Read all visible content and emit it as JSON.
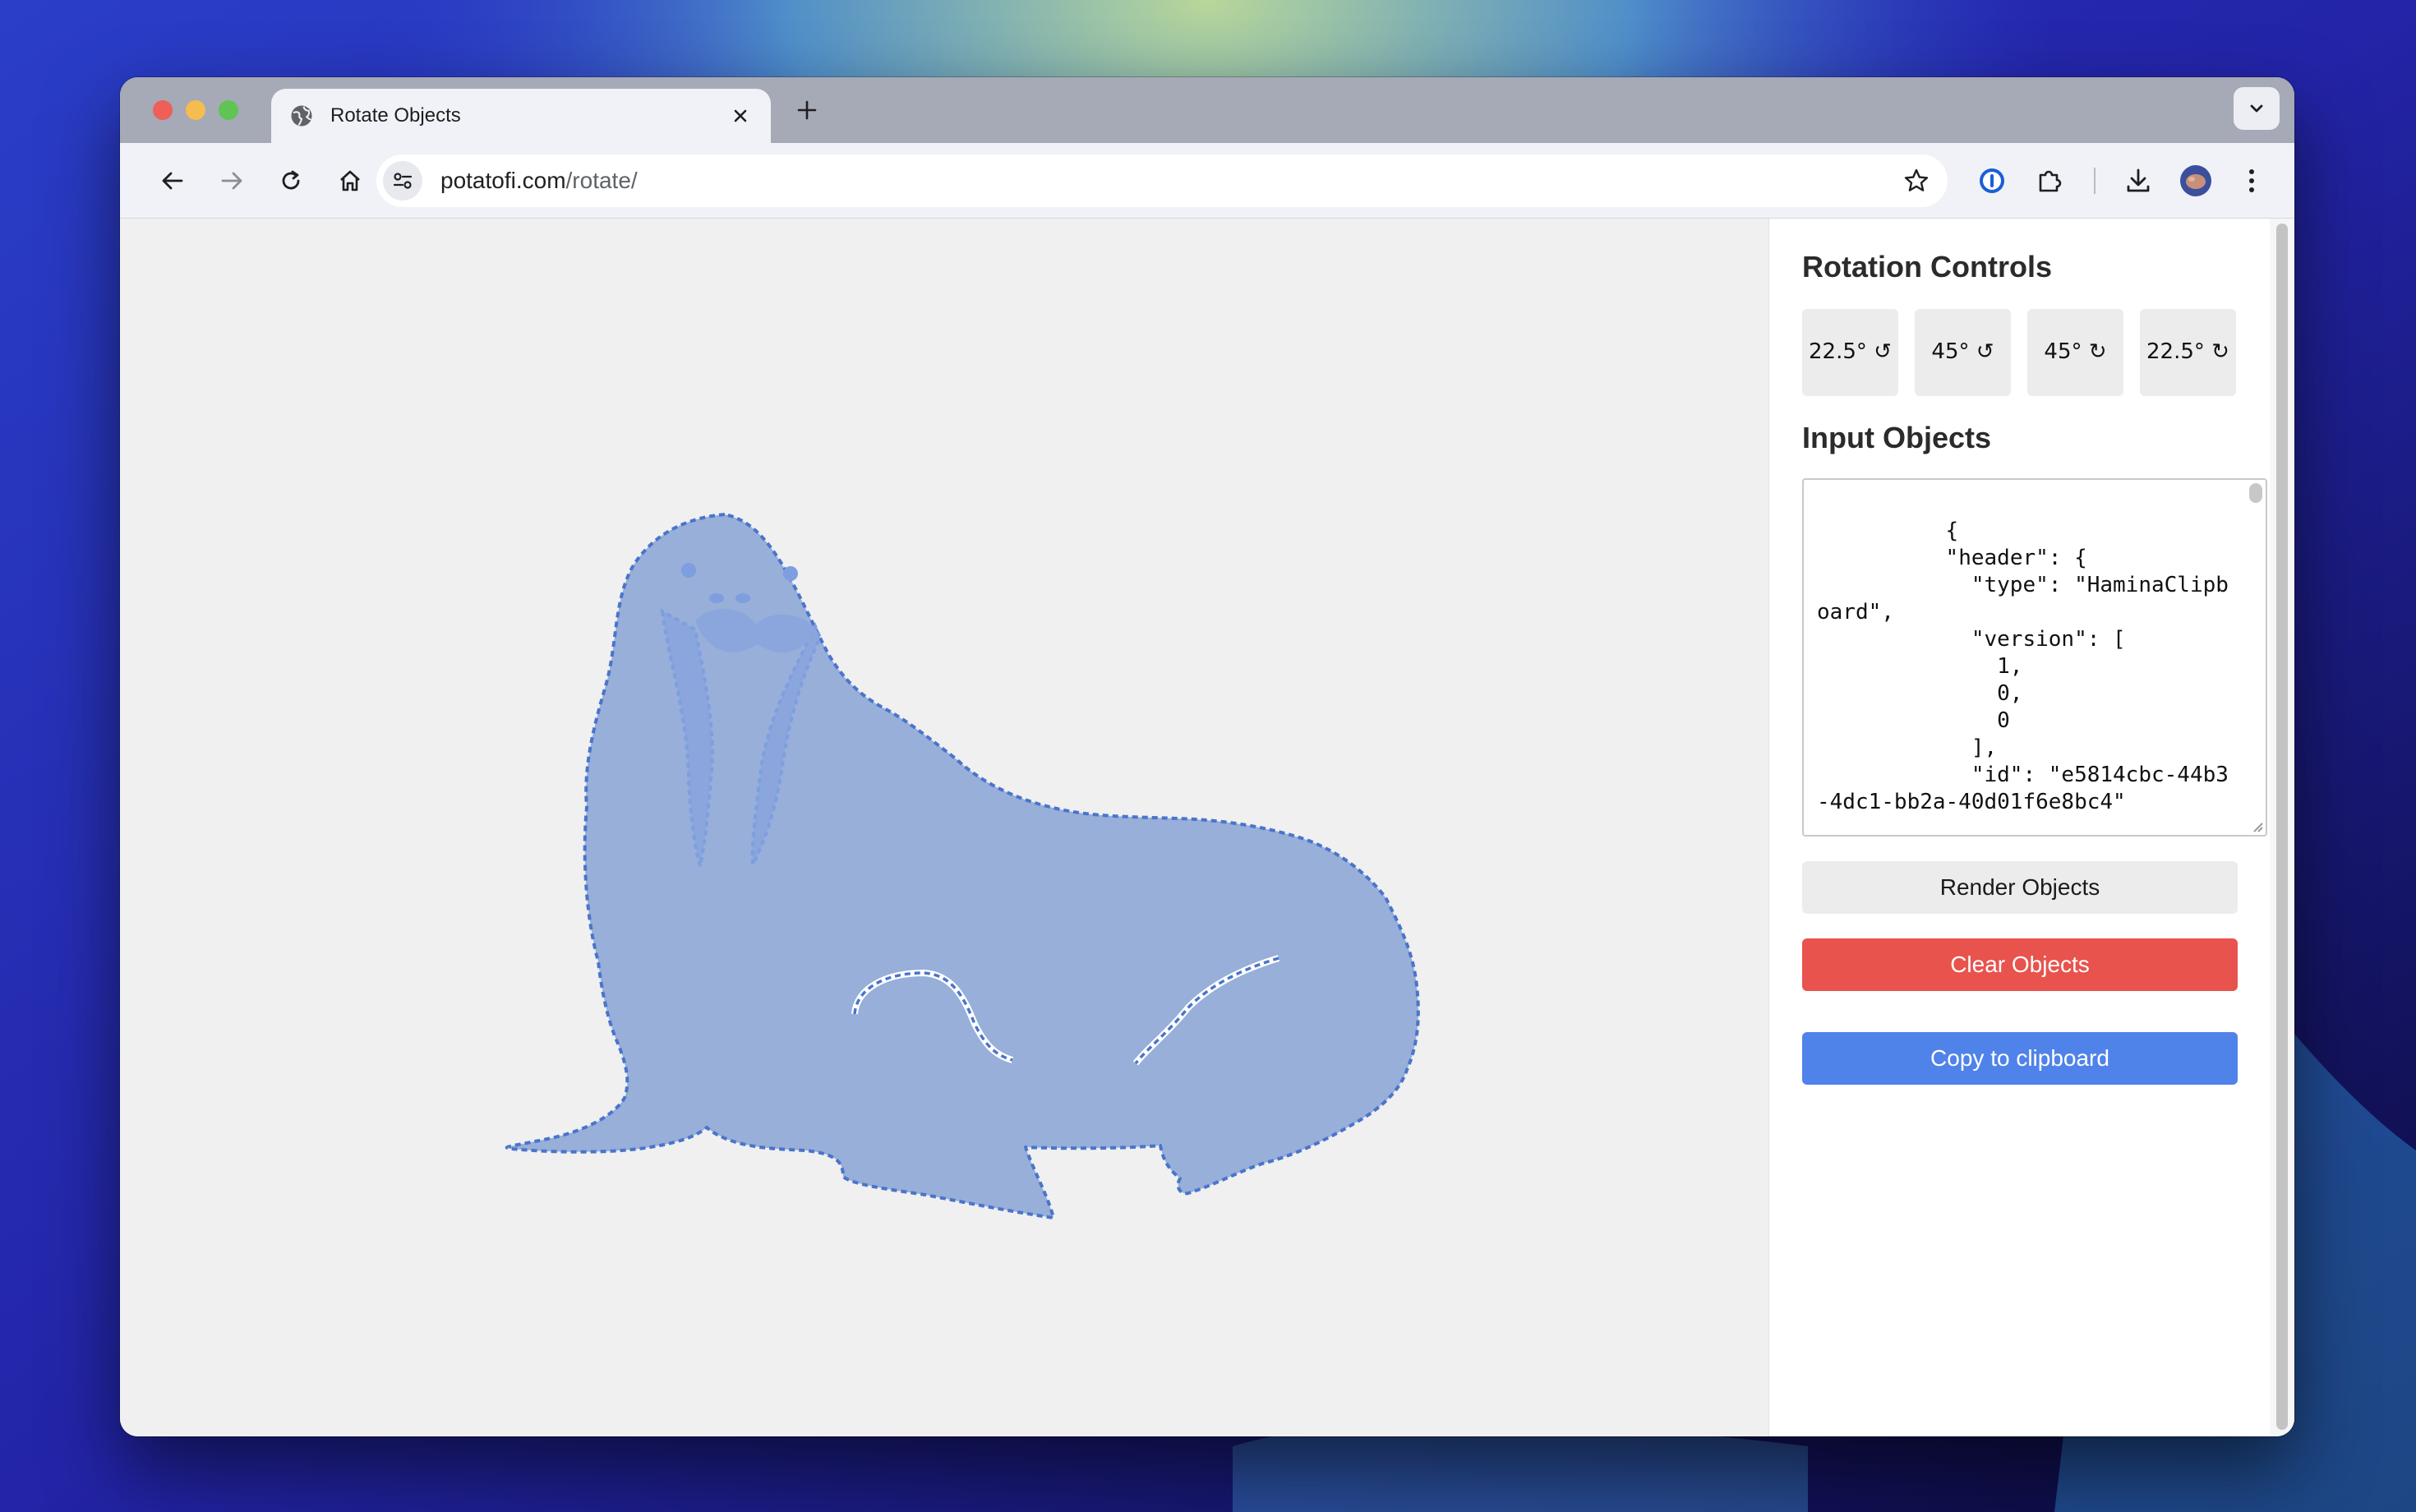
{
  "browser": {
    "tab_title": "Rotate Objects",
    "url_host": "potatofi.com",
    "url_path": "/rotate/"
  },
  "panel": {
    "rotation_heading": "Rotation Controls",
    "rotation_buttons": [
      {
        "label": "22.5° ↺"
      },
      {
        "label": "45° ↺"
      },
      {
        "label": "45° ↻"
      },
      {
        "label": "22.5° ↻"
      }
    ],
    "input_heading": "Input Objects",
    "input_text": "          {\n          \"header\": {\n            \"type\": \"HaminaClipboard\",\n            \"version\": [\n              1,\n              0,\n              0\n            ],\n            \"id\": \"e5814cbc-44b3-4dc1-bb2a-40d01f6e8bc4\"",
    "render_label": "Render Objects",
    "clear_label": "Clear Objects",
    "copy_label": "Copy to clipboard"
  },
  "colors": {
    "clear_button": "#e8534d",
    "copy_button": "#5083e9",
    "walrus_fill": "#97afd9",
    "walrus_stroke": "#4a74cc"
  },
  "icons": [
    "globe-icon",
    "close-icon",
    "plus-icon",
    "chevron-down-icon",
    "back-arrow-icon",
    "forward-arrow-icon",
    "reload-icon",
    "home-icon",
    "site-settings-icon",
    "star-icon",
    "password-manager-icon",
    "extensions-icon",
    "download-icon",
    "profile-avatar",
    "more-menu-icon"
  ]
}
